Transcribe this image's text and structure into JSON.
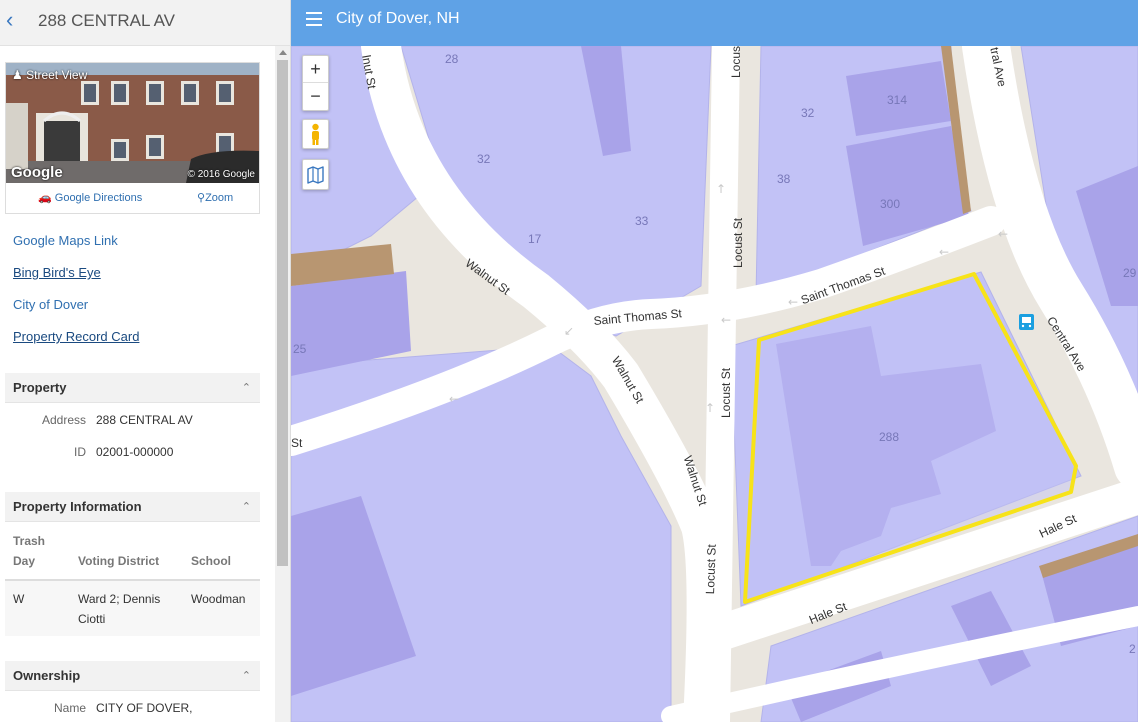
{
  "sidebar": {
    "title": "288 CENTRAL AV",
    "street_view": {
      "label": "Street View",
      "google_mark": "Google",
      "copyright": "© 2016 Google",
      "directions": "Google Directions",
      "zoom": "Zoom"
    },
    "links": [
      "Google Maps Link",
      "Bing Bird's Eye",
      "City of Dover",
      "Property Record Card"
    ],
    "property": {
      "heading": "Property",
      "address_label": "Address",
      "address_value": "288 CENTRAL AV",
      "id_label": "ID",
      "id_value": "02001-000000"
    },
    "property_info": {
      "heading": "Property Information",
      "columns": [
        "Trash Day",
        "Voting District",
        "School"
      ],
      "col0_line1": "Trash",
      "col0_line2": "Day",
      "row": {
        "trash_day": "W",
        "voting_line1": "Ward 2; Dennis",
        "voting_line2": "Ciotti",
        "school": "Woodman"
      }
    },
    "ownership": {
      "heading": "Ownership",
      "name_label": "Name",
      "name_value": "CITY OF DOVER,"
    }
  },
  "topbar": {
    "title": "City of Dover, NH"
  },
  "map": {
    "controls": {
      "zoom_in": "+",
      "zoom_out": "−"
    },
    "streets": {
      "walnut_upper": "Walnut St",
      "walnut_lower": "Walnut St",
      "walnut_bottom": "Walnut St",
      "walnut_top": "lnut St",
      "saint_thomas_left": "Saint Thomas St",
      "saint_thomas_right": "Saint Thomas St",
      "locust_upper": "Locust St",
      "locust_mid": "Locust St",
      "locust_lower": "Locust St",
      "locust_top": "Locust",
      "central_top": "tral Ave",
      "central_side": "Central Ave",
      "hale_right": "Hale St",
      "hale_bottom": "Hale St",
      "st_left": "St"
    },
    "parcel_numbers": [
      "28",
      "32",
      "32",
      "314",
      "38",
      "300",
      "33",
      "17",
      "288",
      "29",
      "25",
      "2"
    ],
    "colors": {
      "parcel": "#c2c2f6",
      "building": "#a9a3e9",
      "road": "#ffffff",
      "ground": "#eae6df",
      "highlight": "#f7e319",
      "bus": "#1a9fe0"
    }
  }
}
